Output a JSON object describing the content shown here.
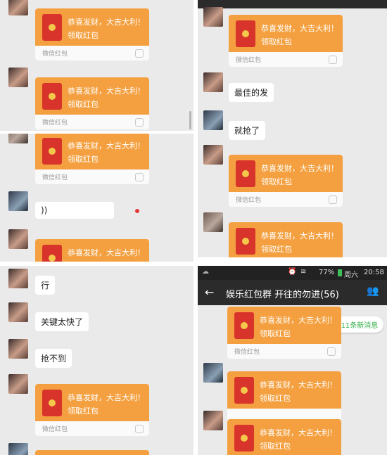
{
  "red_packet": {
    "greeting": "恭喜发财，大吉大利！",
    "claim": "领取红包",
    "footer": "微信红包"
  },
  "messages": {
    "m1": "最佳的发",
    "m2": "就抢了",
    "m3": "行",
    "m4": "关键太快了",
    "m5": "抢不到",
    "voice": "))"
  },
  "status_bar": {
    "battery": "77%",
    "weekday": "周六",
    "time": "20:58"
  },
  "chat": {
    "title": "娱乐红包群 开往的勿进(56)",
    "new_messages": "11条新消息"
  },
  "colors": {
    "packet_orange": "#f4a040",
    "envelope_red": "#d9342b",
    "accent_green": "#34b34a"
  }
}
